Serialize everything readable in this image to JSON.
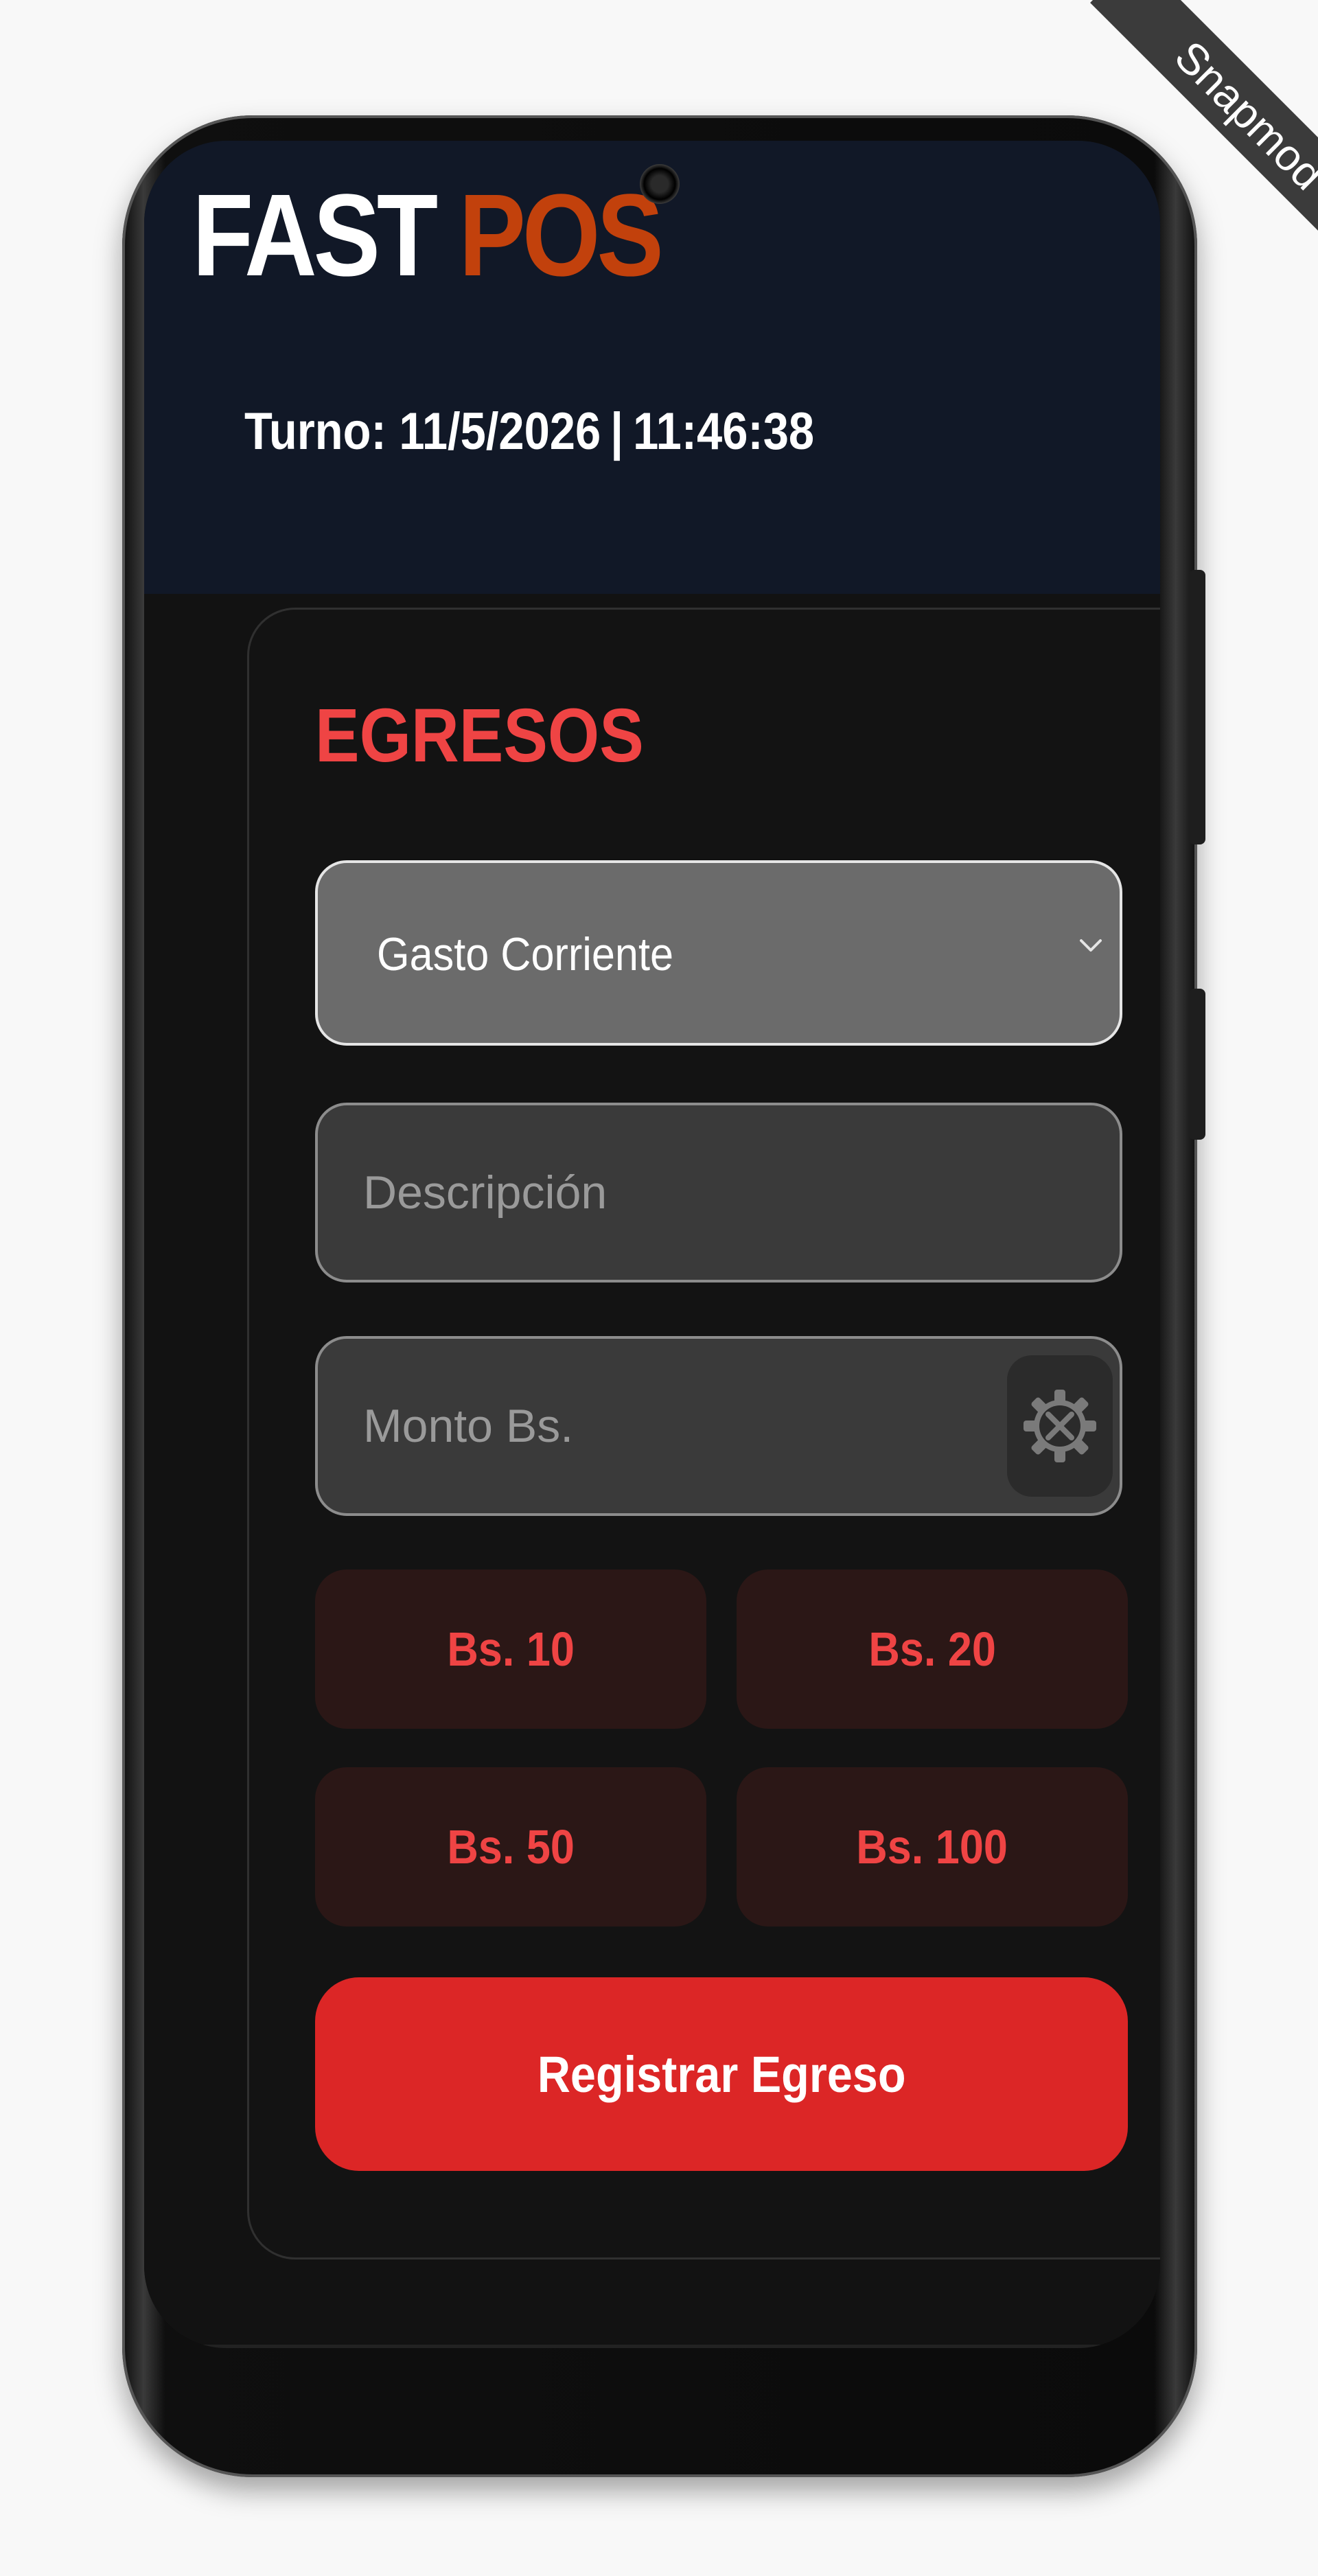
{
  "app": {
    "logo_primary": "FAST",
    "logo_secondary": "POS",
    "shift_label": "Turno:",
    "shift_date": "11/5/2026",
    "shift_separator": "|",
    "shift_time": "11:46:38"
  },
  "form": {
    "title": "EGRESOS",
    "category": {
      "selected": "Gasto Corriente"
    },
    "description": {
      "placeholder": "Descripción",
      "value": ""
    },
    "amount": {
      "placeholder": "Monto Bs.",
      "value": "",
      "tool_icon": "gear-tools-icon"
    },
    "quick_amounts": [
      "Bs. 10",
      "Bs. 20",
      "Bs. 50",
      "Bs. 100"
    ],
    "submit_label": "Registrar Egreso"
  },
  "watermark": {
    "label": "Snapmod"
  },
  "colors": {
    "header_bg": "#111827",
    "logo_accent": "#c2410c",
    "title_red": "#ef4444",
    "submit_red": "#dc2626",
    "quick_bg": "#2b1716",
    "card_bg": "#131313"
  }
}
